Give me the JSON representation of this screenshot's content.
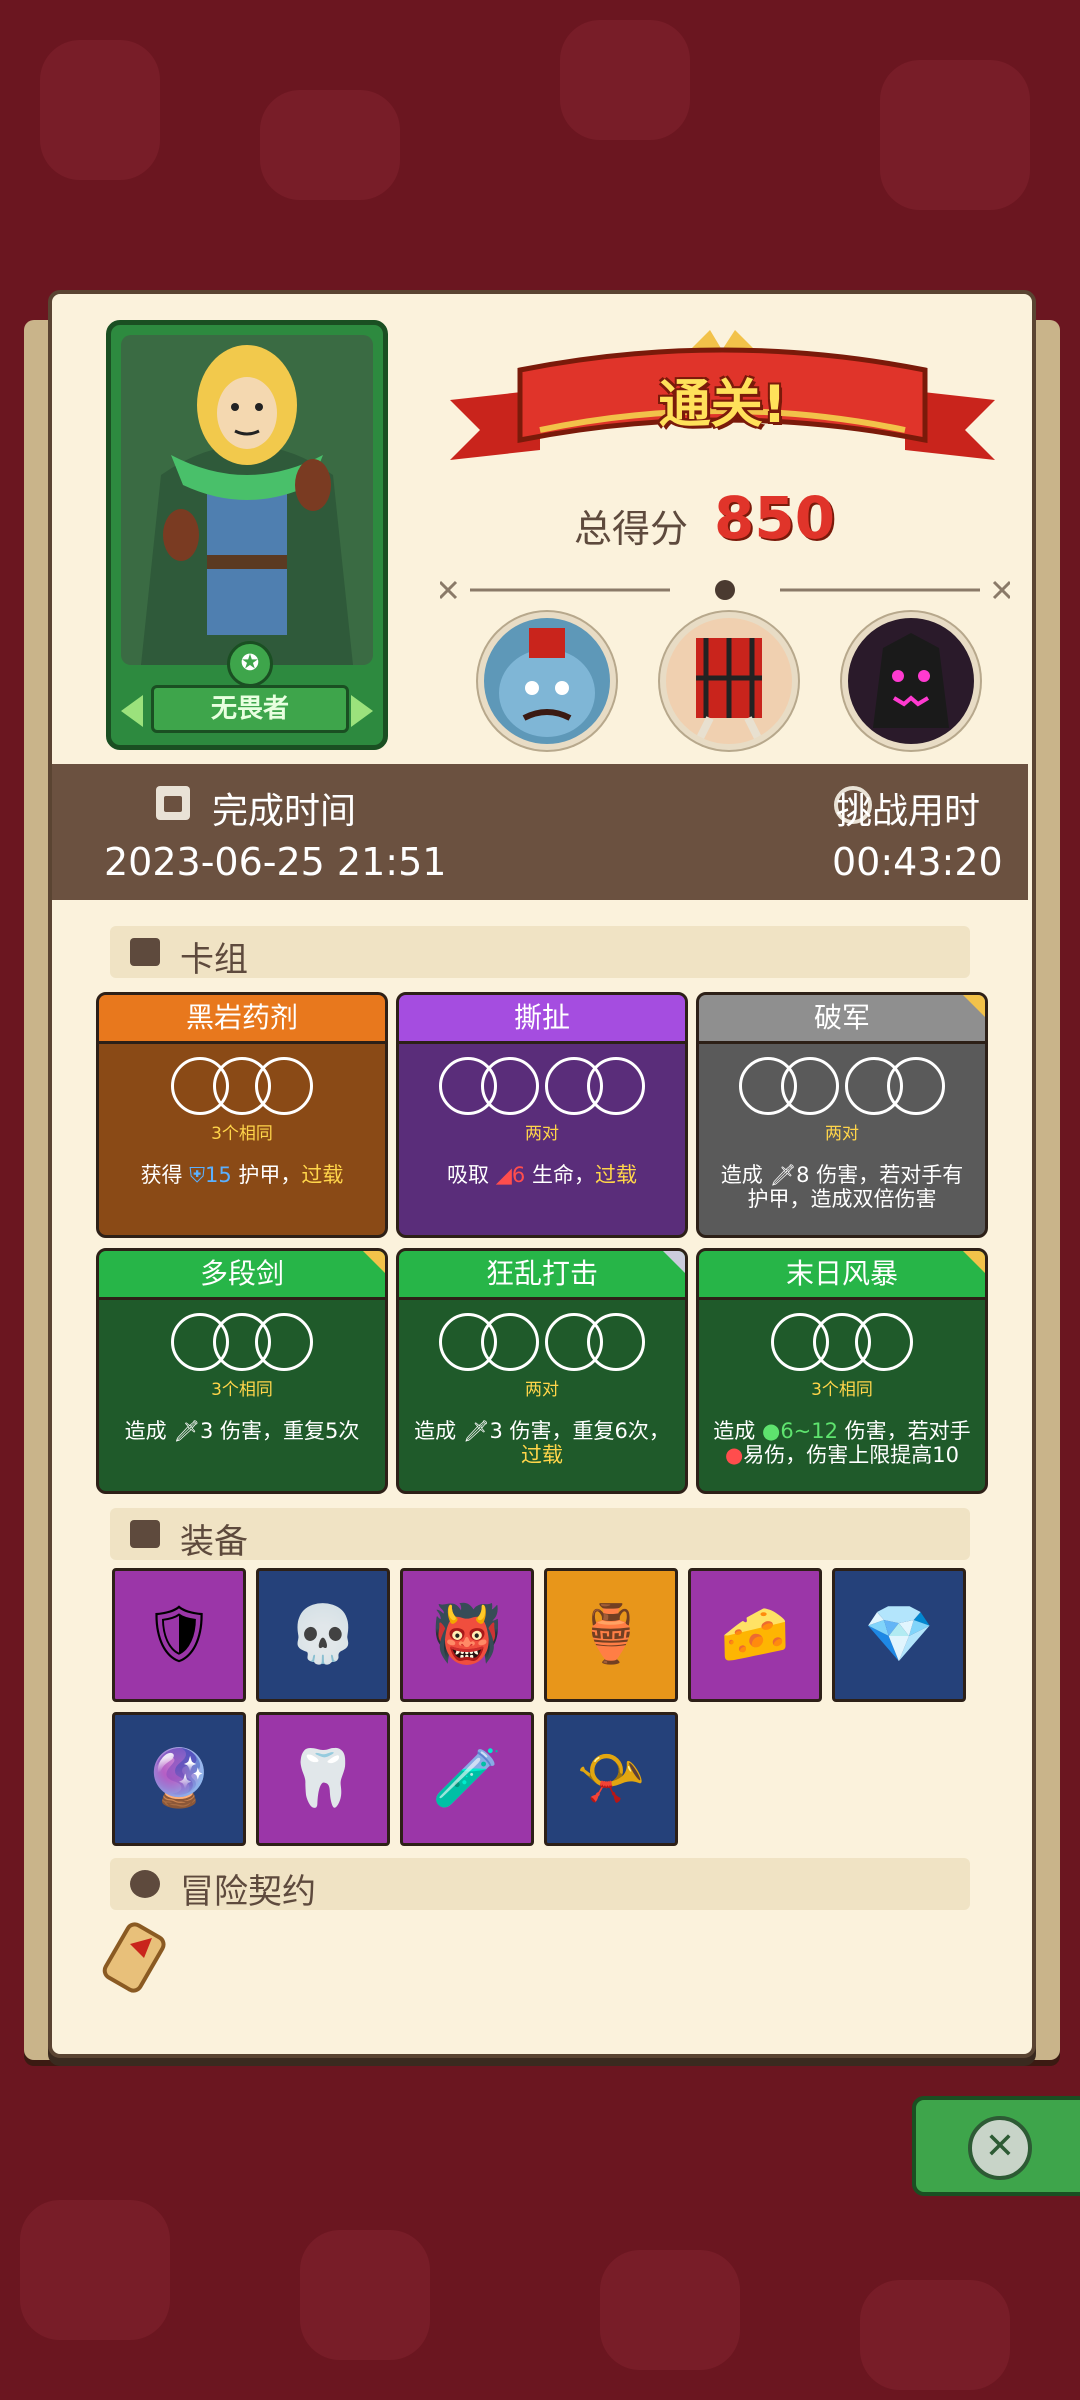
{
  "result": {
    "title": "通关!",
    "score_label": "总得分",
    "score": "850"
  },
  "hero": {
    "name": "无畏者"
  },
  "stats": {
    "completion_label": "完成时间",
    "completion_value": "2023-06-25 21:51",
    "duration_label": "挑战用时",
    "duration_value": "00:43:20"
  },
  "deck": {
    "title": "卡组",
    "cards": [
      {
        "name": "黑岩药剂",
        "sub": "3个相同",
        "desc_a": "获得 ",
        "amount": "15",
        "desc_b": " 护甲，",
        "tag": "过载"
      },
      {
        "name": "撕扯",
        "sub": "两对",
        "desc_a": "吸取 ",
        "amount": "6",
        "desc_b": " 生命，",
        "tag": "过载"
      },
      {
        "name": "破军",
        "sub": "两对",
        "desc_a": "造成 ",
        "amount": "8",
        "desc_b": " 伤害，若对手有护甲，造成双倍伤害",
        "tag": ""
      },
      {
        "name": "多段剑",
        "sub": "3个相同",
        "desc_a": "造成 ",
        "amount": "3",
        "desc_b": " 伤害，重复5次",
        "tag": ""
      },
      {
        "name": "狂乱打击",
        "sub": "两对",
        "desc_a": "造成 ",
        "amount": "3",
        "desc_b": " 伤害，重复6次，",
        "tag": "过载"
      },
      {
        "name": "末日风暴",
        "sub": "3个相同",
        "desc_a": "造成 ",
        "amount": "6~12",
        "desc_b": " 伤害，若对手",
        "tag": "",
        "desc_c": "易伤，伤害上限提高10"
      }
    ]
  },
  "equipment": {
    "title": "装备",
    "items": [
      {
        "icon": "leather-bracer-icon",
        "color": "#9b36a8"
      },
      {
        "icon": "horned-skull-icon",
        "color": "#25417a"
      },
      {
        "icon": "demon-mask-shield-icon",
        "color": "#9b36a8"
      },
      {
        "icon": "jade-vase-icon",
        "color": "#e8961a"
      },
      {
        "icon": "cheese-wedge-icon",
        "color": "#9b36a8"
      },
      {
        "icon": "blue-crystal-icon",
        "color": "#25417a"
      },
      {
        "icon": "pink-d20-gem-icon",
        "color": "#25417a"
      },
      {
        "icon": "fangs-icon",
        "color": "#9b36a8"
      },
      {
        "icon": "purple-potion-icon",
        "color": "#9b36a8"
      },
      {
        "icon": "horn-flute-icon",
        "color": "#25417a"
      }
    ]
  },
  "contract": {
    "title": "冒险契约"
  }
}
